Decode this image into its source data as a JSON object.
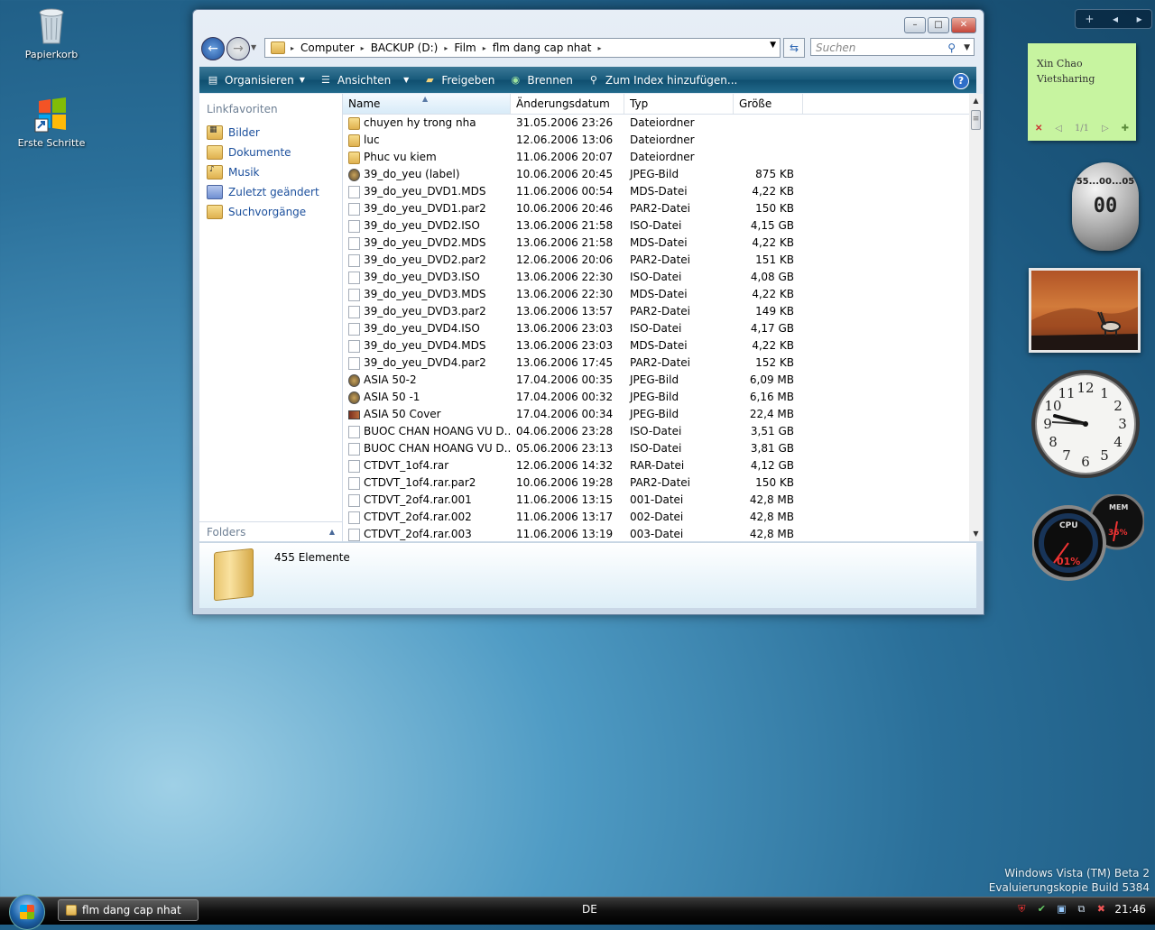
{
  "desktop": {
    "icons": [
      {
        "label": "Papierkorb",
        "icon": "recycle-bin-icon"
      },
      {
        "label": "Erste Schritte",
        "icon": "windows-logo-icon"
      }
    ],
    "watermark": {
      "line1": "Windows Vista (TM) Beta 2",
      "line2": "Evaluierungskopie Build 5384"
    }
  },
  "window": {
    "title": "flm dang cap nhat",
    "caption_buttons": {
      "minimize": "–",
      "maximize": "□",
      "close": "✕"
    },
    "nav": {
      "back": "←",
      "forward": "→",
      "dropdown": "▼"
    },
    "address": {
      "segments": [
        "Computer",
        "BACKUP (D:)",
        "Film",
        "flm dang cap nhat"
      ]
    },
    "search": {
      "placeholder": "Suchen"
    },
    "toolbar": {
      "organize": "Organisieren",
      "views": "Ansichten",
      "share": "Freigeben",
      "burn": "Brennen",
      "index": "Zum Index hinzufügen...",
      "help": "?"
    },
    "left_pane": {
      "header": "Linkfavoriten",
      "items": [
        "Bilder",
        "Dokumente",
        "Musik",
        "Zuletzt geändert",
        "Suchvorgänge"
      ],
      "folders_label": "Folders"
    },
    "columns": {
      "name": "Name",
      "date": "Änderungsdatum",
      "type": "Typ",
      "size": "Größe"
    },
    "files": [
      {
        "name": "chuyen hy trong nha",
        "date": "31.05.2006 23:26",
        "type": "Dateiordner",
        "size": "",
        "icon": "folder"
      },
      {
        "name": "luc",
        "date": "12.06.2006 13:06",
        "type": "Dateiordner",
        "size": "",
        "icon": "folder"
      },
      {
        "name": "Phuc vu kiem",
        "date": "11.06.2006 20:07",
        "type": "Dateiordner",
        "size": "",
        "icon": "folder"
      },
      {
        "name": "39_do_yeu (label)",
        "date": "10.06.2006 20:45",
        "type": "JPEG-Bild",
        "size": "875 KB",
        "icon": "jpeg"
      },
      {
        "name": "39_do_yeu_DVD1.MDS",
        "date": "11.06.2006 00:54",
        "type": "MDS-Datei",
        "size": "4,22 KB",
        "icon": "file"
      },
      {
        "name": "39_do_yeu_DVD1.par2",
        "date": "10.06.2006 20:46",
        "type": "PAR2-Datei",
        "size": "150 KB",
        "icon": "file"
      },
      {
        "name": "39_do_yeu_DVD2.ISO",
        "date": "13.06.2006 21:58",
        "type": "ISO-Datei",
        "size": "4,15 GB",
        "icon": "file"
      },
      {
        "name": "39_do_yeu_DVD2.MDS",
        "date": "13.06.2006 21:58",
        "type": "MDS-Datei",
        "size": "4,22 KB",
        "icon": "file"
      },
      {
        "name": "39_do_yeu_DVD2.par2",
        "date": "12.06.2006 20:06",
        "type": "PAR2-Datei",
        "size": "151 KB",
        "icon": "file"
      },
      {
        "name": "39_do_yeu_DVD3.ISO",
        "date": "13.06.2006 22:30",
        "type": "ISO-Datei",
        "size": "4,08 GB",
        "icon": "file"
      },
      {
        "name": "39_do_yeu_DVD3.MDS",
        "date": "13.06.2006 22:30",
        "type": "MDS-Datei",
        "size": "4,22 KB",
        "icon": "file"
      },
      {
        "name": "39_do_yeu_DVD3.par2",
        "date": "13.06.2006 13:57",
        "type": "PAR2-Datei",
        "size": "149 KB",
        "icon": "file"
      },
      {
        "name": "39_do_yeu_DVD4.ISO",
        "date": "13.06.2006 23:03",
        "type": "ISO-Datei",
        "size": "4,17 GB",
        "icon": "file"
      },
      {
        "name": "39_do_yeu_DVD4.MDS",
        "date": "13.06.2006 23:03",
        "type": "MDS-Datei",
        "size": "4,22 KB",
        "icon": "file"
      },
      {
        "name": "39_do_yeu_DVD4.par2",
        "date": "13.06.2006 17:45",
        "type": "PAR2-Datei",
        "size": "152 KB",
        "icon": "file"
      },
      {
        "name": "ASIA 50-2",
        "date": "17.04.2006 00:35",
        "type": "JPEG-Bild",
        "size": "6,09 MB",
        "icon": "jpeg"
      },
      {
        "name": "ASIA 50 -1",
        "date": "17.04.2006 00:32",
        "type": "JPEG-Bild",
        "size": "6,16 MB",
        "icon": "jpeg"
      },
      {
        "name": "ASIA 50 Cover",
        "date": "17.04.2006 00:34",
        "type": "JPEG-Bild",
        "size": "22,4 MB",
        "icon": "img"
      },
      {
        "name": "BUOC CHAN HOANG VU D...",
        "date": "04.06.2006 23:28",
        "type": "ISO-Datei",
        "size": "3,51 GB",
        "icon": "file"
      },
      {
        "name": "BUOC CHAN HOANG VU D...",
        "date": "05.06.2006 23:13",
        "type": "ISO-Datei",
        "size": "3,81 GB",
        "icon": "file"
      },
      {
        "name": "CTDVT_1of4.rar",
        "date": "12.06.2006 14:32",
        "type": "RAR-Datei",
        "size": "4,12 GB",
        "icon": "file"
      },
      {
        "name": "CTDVT_1of4.rar.par2",
        "date": "10.06.2006 19:28",
        "type": "PAR2-Datei",
        "size": "150 KB",
        "icon": "file"
      },
      {
        "name": "CTDVT_2of4.rar.001",
        "date": "11.06.2006 13:15",
        "type": "001-Datei",
        "size": "42,8 MB",
        "icon": "file"
      },
      {
        "name": "CTDVT_2of4.rar.002",
        "date": "11.06.2006 13:17",
        "type": "002-Datei",
        "size": "42,8 MB",
        "icon": "file"
      },
      {
        "name": "CTDVT_2of4.rar.003",
        "date": "11.06.2006 13:19",
        "type": "003-Datei",
        "size": "42,8 MB",
        "icon": "file"
      }
    ],
    "details": {
      "count": "455 Elemente"
    }
  },
  "sidebar": {
    "bar": {
      "add": "+",
      "prev": "◂",
      "next": "▸"
    },
    "note": {
      "line1": "Xin Chao",
      "line2": "Vietsharing",
      "page": "1/1"
    },
    "timer": {
      "top": "55...00...05",
      "value": "00"
    },
    "meter": {
      "cpu_label": "CPU",
      "cpu_value": "01%",
      "mem_label": "MEM",
      "mem_value": "36%"
    }
  },
  "taskbar": {
    "task": "flm dang cap nhat",
    "language": "DE",
    "time": "21:46"
  }
}
